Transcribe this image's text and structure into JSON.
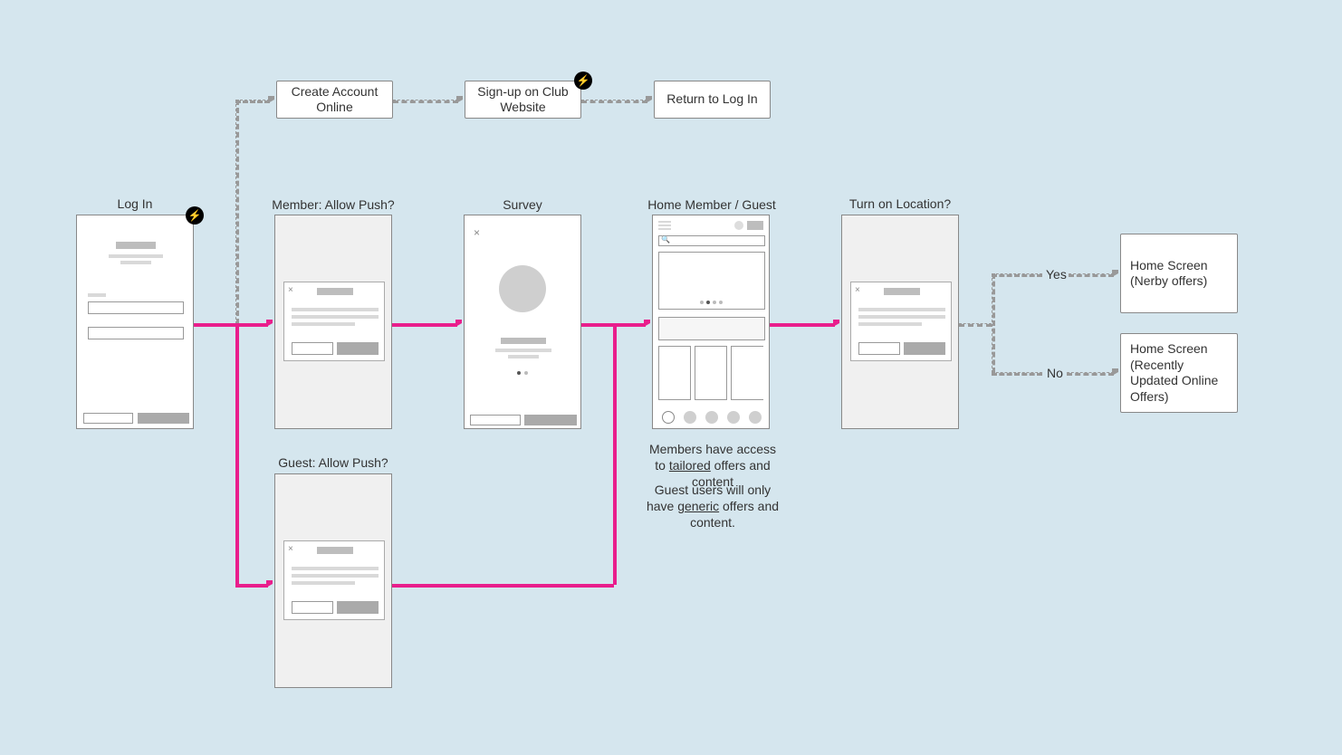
{
  "top_flow": {
    "create_account": "Create Account Online",
    "signup_club": "Sign-up on Club Website",
    "return_login": "Return to Log In"
  },
  "screens": {
    "login": "Log In",
    "member_push": "Member: Allow Push?",
    "guest_push": "Guest: Allow Push?",
    "survey": "Survey",
    "home_member_guest": "Home Member / Guest",
    "location": "Turn on Location?"
  },
  "decision": {
    "yes": "Yes",
    "no": "No"
  },
  "outcomes": {
    "home_nearby": "Home Screen (Nerby offers)",
    "home_online": "Home Screen (Recently Updated Online Offers)"
  },
  "caption": {
    "line1_prefix": "Members have access to ",
    "line1_underlined": "tailored",
    "line1_suffix": " offers and content",
    "line2_prefix": "Guest users will only have ",
    "line2_underlined": "generic",
    "line2_suffix": " offers and content."
  },
  "icons": {
    "lightning": "⚡",
    "close": "×",
    "search": "🔍"
  }
}
